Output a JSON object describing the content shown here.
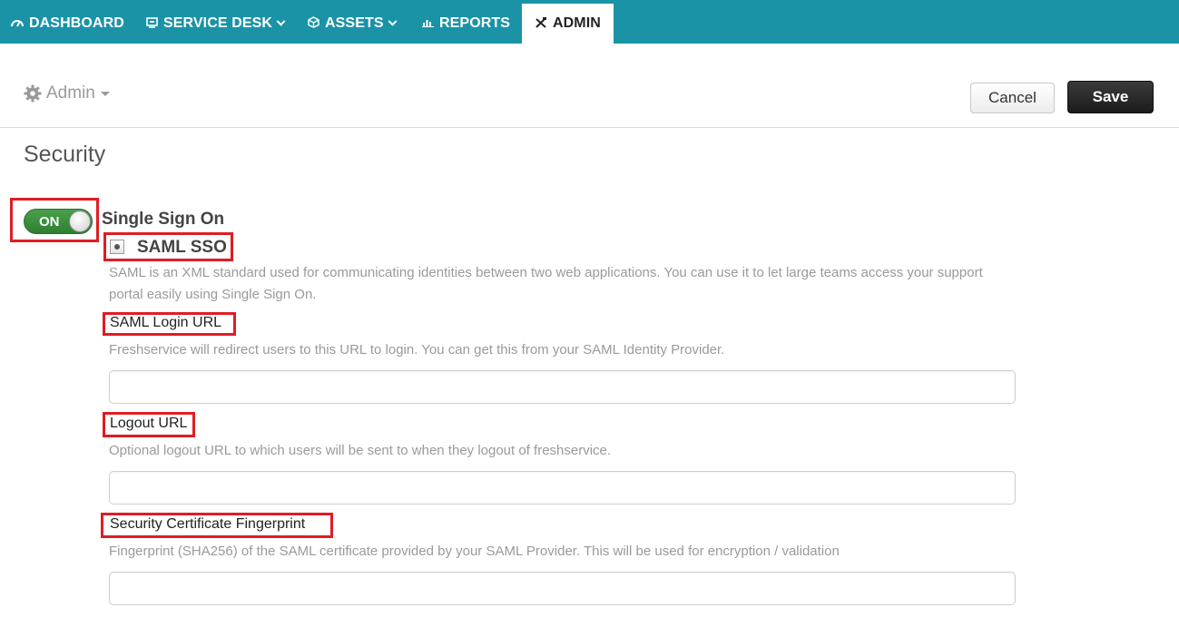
{
  "nav": {
    "items": [
      {
        "label": "DASHBOARD",
        "icon": "speedometer-icon"
      },
      {
        "label": "SERVICE DESK",
        "icon": "desk-icon"
      },
      {
        "label": "ASSETS",
        "icon": "cube-icon"
      },
      {
        "label": "REPORTS",
        "icon": "bar-chart-icon"
      },
      {
        "label": "ADMIN",
        "icon": "tools-icon"
      }
    ],
    "active": "ADMIN",
    "bg_color": "#1a93a7"
  },
  "header": {
    "breadcrumb": "Admin",
    "cancel_label": "Cancel",
    "save_label": "Save"
  },
  "section": {
    "title": "Security"
  },
  "sso": {
    "toggle_label": "ON",
    "title": "Single Sign On",
    "saml_title": "SAML SSO",
    "saml_desc": "SAML is an XML standard used for communicating identities between two web applications. You can use it to let large teams access your support portal easily using Single Sign On.",
    "fields": [
      {
        "label": "SAML Login URL",
        "desc": "Freshservice will redirect users to this URL to login. You can get this from your SAML Identity Provider.",
        "value": ""
      },
      {
        "label": "Logout URL",
        "desc": "Optional logout URL to which users will be sent to when they logout of freshservice.",
        "value": ""
      },
      {
        "label": "Security Certificate Fingerprint",
        "desc": "Fingerprint (SHA256) of the SAML certificate provided by your SAML Provider. This will be used for encryption / validation",
        "value": ""
      }
    ]
  },
  "colors": {
    "highlight": "#e01c24",
    "toggle_on": "#3a8f3d"
  }
}
